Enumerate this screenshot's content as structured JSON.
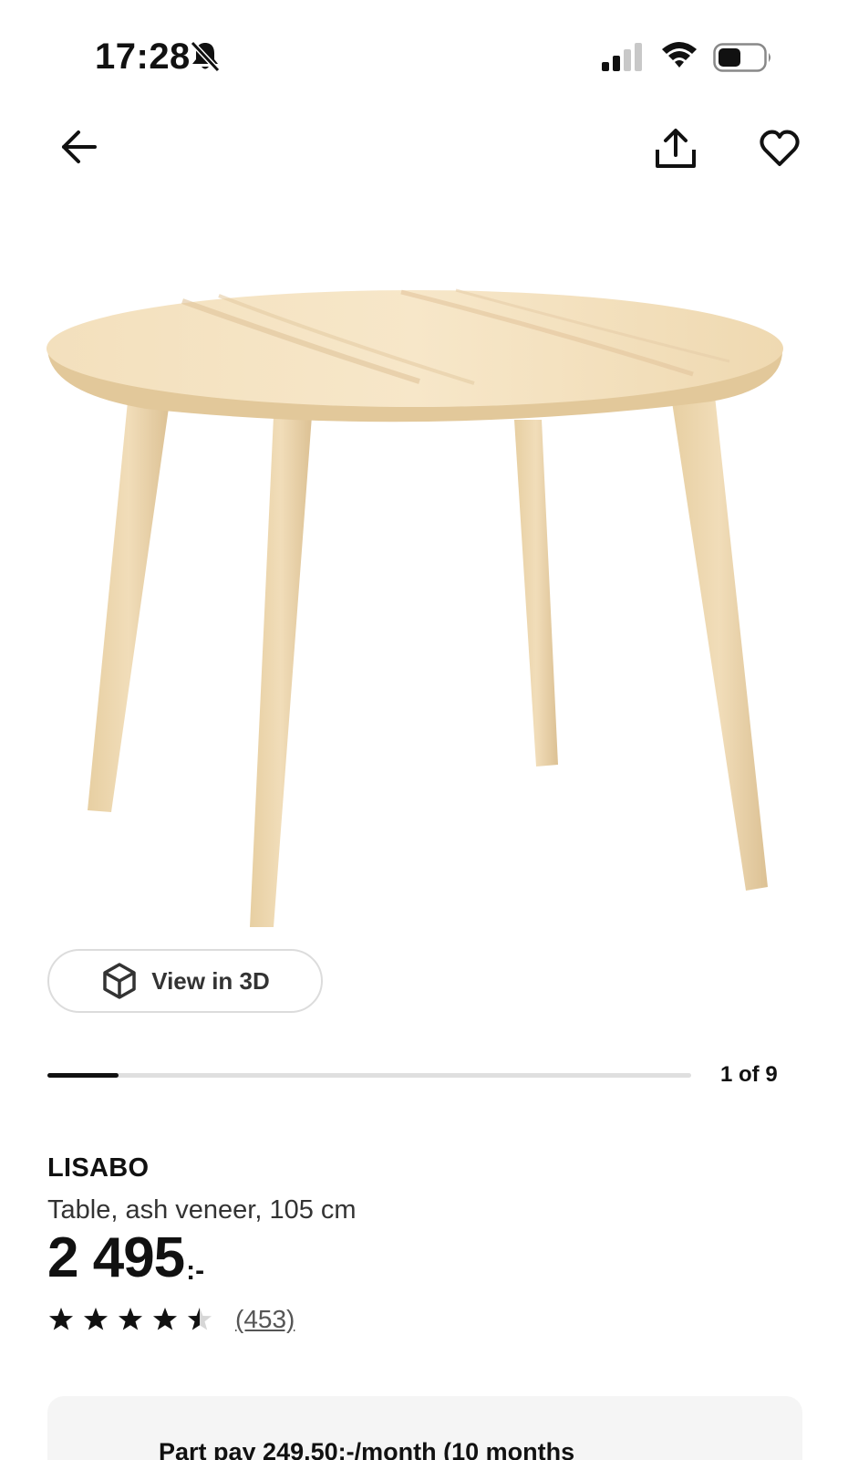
{
  "status_bar": {
    "time": "17:28",
    "icons": [
      "bell-slash-icon",
      "cellular-signal-icon",
      "wifi-icon",
      "battery-icon"
    ],
    "signal_bars_active": 2,
    "signal_bars_total": 4,
    "battery_level": 0.5
  },
  "nav": {
    "icons": [
      "arrow-left-icon",
      "share-icon",
      "heart-icon"
    ]
  },
  "product": {
    "image_icon": "round-table-illustration",
    "view3d_label": "View in 3D",
    "carousel": {
      "counter": "1 of 9",
      "current": 1,
      "total": 9
    },
    "name": "LISABO",
    "description": "Table, ash veneer, 105 cm",
    "price_value": "2 495",
    "price_suffix": ":-",
    "rating": {
      "value": 4.5,
      "max": 5
    },
    "review_count": "(453)"
  },
  "part_pay": {
    "text": "Part pay 249.50:-/month (10 months"
  },
  "colors": {
    "text_primary": "#111111",
    "track": "#dfdfdf",
    "partpay_bg": "#f5f5f5",
    "wood": "#ead4ac"
  }
}
